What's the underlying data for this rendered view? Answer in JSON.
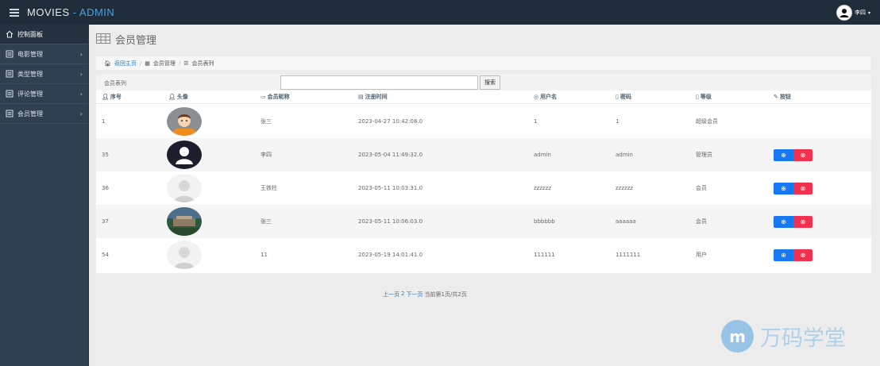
{
  "brand": {
    "name": "MOVIES",
    "separator": " - ",
    "suffix": "ADMIN"
  },
  "user": {
    "name": "李四"
  },
  "sidebar": {
    "items": [
      {
        "label": "控制面板"
      },
      {
        "label": "电影管理"
      },
      {
        "label": "类型管理"
      },
      {
        "label": "评论管理"
      },
      {
        "label": "会员管理"
      }
    ]
  },
  "page": {
    "title": "会员管理"
  },
  "breadcrumb": {
    "home": "返回主页",
    "section": "会员管理",
    "current": "会员表列"
  },
  "search": {
    "label": "会员表列",
    "value": "",
    "button": "搜索"
  },
  "table": {
    "headers": [
      "序号",
      "头像",
      "会员昵称",
      "注册时间",
      "用户名",
      "密码",
      "等级",
      "按钮"
    ],
    "rows": [
      {
        "id": "1",
        "nickname": "张三",
        "time": "2023-04-27 10:42:08.0",
        "username": "1",
        "password": "1",
        "level": "超级会员",
        "avatar": "cartoon"
      },
      {
        "id": "35",
        "nickname": "李四",
        "time": "2023-05-04 11:49:32.0",
        "username": "admin",
        "password": "admin",
        "level": "管理员",
        "avatar": "silhouette"
      },
      {
        "id": "36",
        "nickname": "王铁柱",
        "time": "2023-05-11 10:03:31.0",
        "username": "zzzzzz",
        "password": "zzzzzz",
        "level": "会员",
        "avatar": "default"
      },
      {
        "id": "37",
        "nickname": "张三",
        "time": "2023-05-11 10:06:03.0",
        "username": "bbbbbb",
        "password": "aaaaaa",
        "level": "会员",
        "avatar": "building"
      },
      {
        "id": "54",
        "nickname": "11",
        "time": "2023-05-19 14:01:41.0",
        "username": "111111",
        "password": "1111111",
        "level": "用户",
        "avatar": "default"
      }
    ]
  },
  "pagination": {
    "prev": "上一页",
    "page2": "2",
    "next": "下一页",
    "info": "当前第1页/共2页"
  },
  "watermark": {
    "text": "万码学堂"
  },
  "colors": {
    "navbar": "#1f2d3a",
    "sidebar": "#2f4050",
    "accent": "#4aa3df",
    "edit": "#1678f2",
    "delete": "#f1314d"
  }
}
